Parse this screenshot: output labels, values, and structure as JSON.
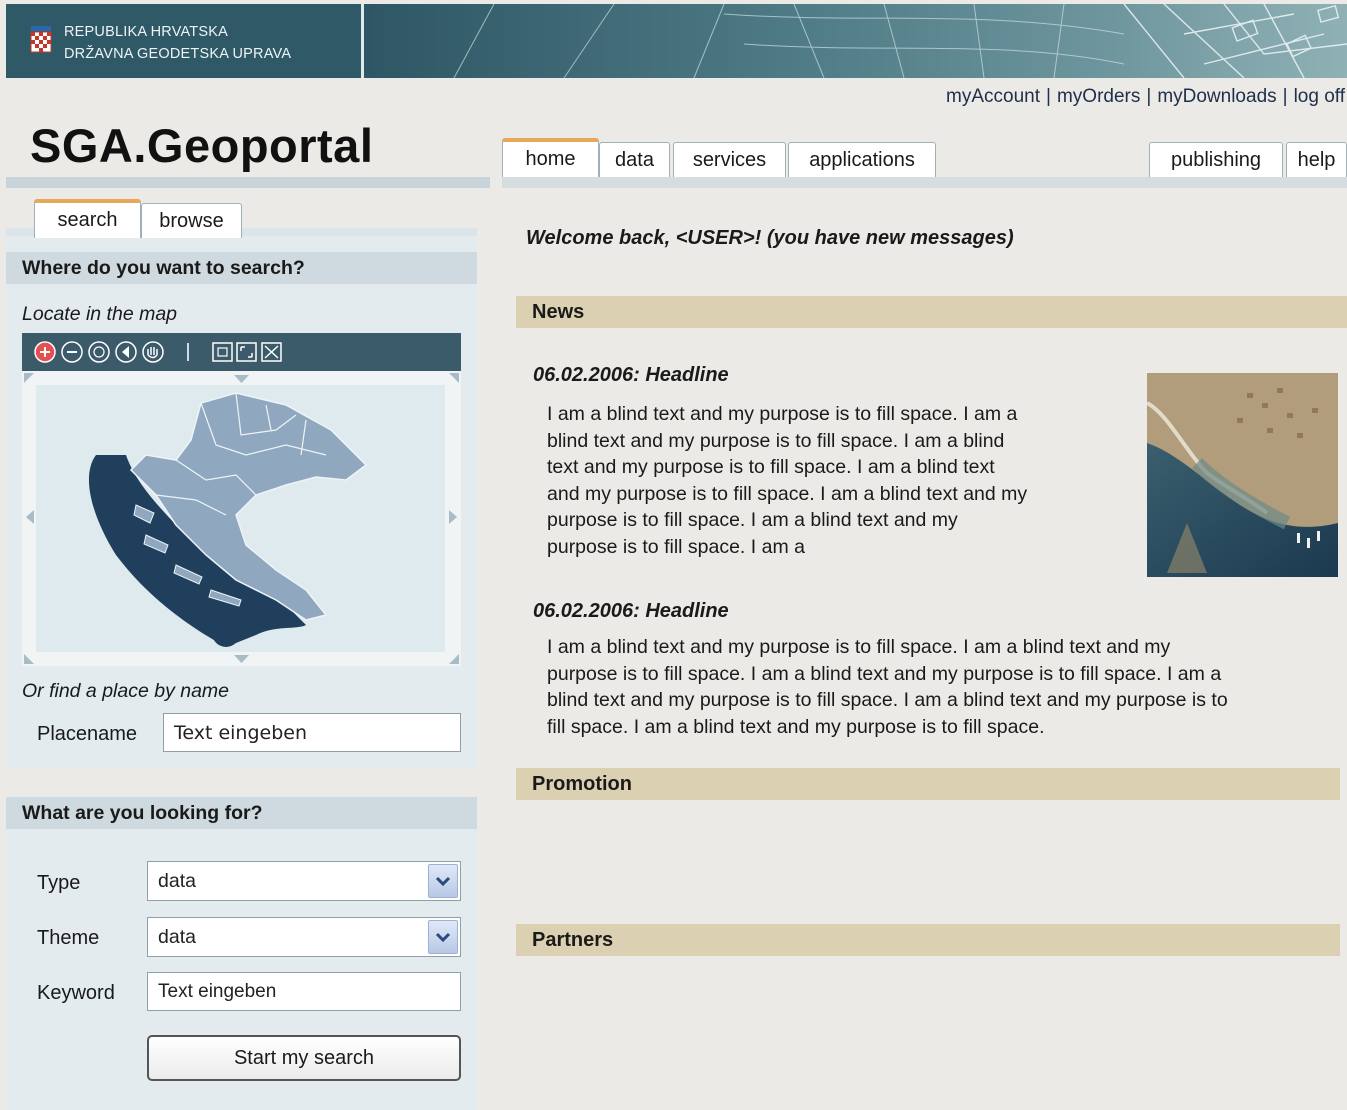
{
  "banner": {
    "line1": "REPUBLIKA HRVATSKA",
    "line2": "DRŽAVNA GEODETSKA UPRAVA"
  },
  "toplinks": [
    "myAccount",
    "myOrders",
    "myDownloads",
    "log off"
  ],
  "site_title": "SGA.Geoportal",
  "main_tabs": {
    "home": "home",
    "data": "data",
    "services": "services",
    "applications": "applications",
    "publishing": "publishing",
    "help": "help"
  },
  "side_tabs": {
    "search": "search",
    "browse": "browse"
  },
  "where": {
    "heading": "Where do you want to search?",
    "locate_label": "Locate in the map",
    "find_label": "Or find a place by name",
    "placename_label": "Placename",
    "placename_value": "Text eingeben"
  },
  "what": {
    "heading": "What are you looking for?",
    "type_label": "Type",
    "type_value": "data",
    "theme_label": "Theme",
    "theme_value": "data",
    "keyword_label": "Keyword",
    "keyword_value": "Text eingeben",
    "button": "Start my search"
  },
  "welcome": "Welcome back, <USER>! (you have new messages)",
  "news": {
    "heading": "News",
    "items": [
      {
        "headline": "06.02.2006: Headline",
        "lines": [
          "I am a blind text and my purpose is to fill space. I am a",
          "blind text and my purpose is to fill space. I am a blind",
          "text and my purpose is to fill space. I am a blind text",
          "and my purpose is to fill space. I am a blind text and my",
          "purpose is to fill space. I am a blind text and my",
          "purpose is to fill space. I am a"
        ]
      },
      {
        "headline": "06.02.2006: Headline",
        "lines": [
          "I am a blind text and my purpose is to fill space. I am a blind text and my",
          "purpose is to fill space. I am a blind text and my purpose is to fill space. I am a",
          "blind text and my purpose is to fill space. I am a blind text and my purpose is to",
          "fill space. I am a blind text and my purpose is to fill space."
        ]
      }
    ]
  },
  "promotion": {
    "heading": "Promotion"
  },
  "partners": {
    "heading": "Partners"
  },
  "icons": {
    "map_toolbar": [
      "zoom-in-icon",
      "zoom-out-icon",
      "zoom-region-icon",
      "back-icon",
      "pan-hand-icon",
      "full-extent-icon",
      "fit-window-icon",
      "clear-icon"
    ],
    "select_arrow": "chevron-down-icon"
  },
  "colors": {
    "accent_tab": "#e8a85b",
    "left_panel": "#e3ebee",
    "section_blue": "#cfdae0",
    "section_tan": "#dcd0b3",
    "map_toolbar": "#3b5a6a",
    "map_land": "#8fa8bf",
    "map_sea": "#1f3f5c"
  }
}
